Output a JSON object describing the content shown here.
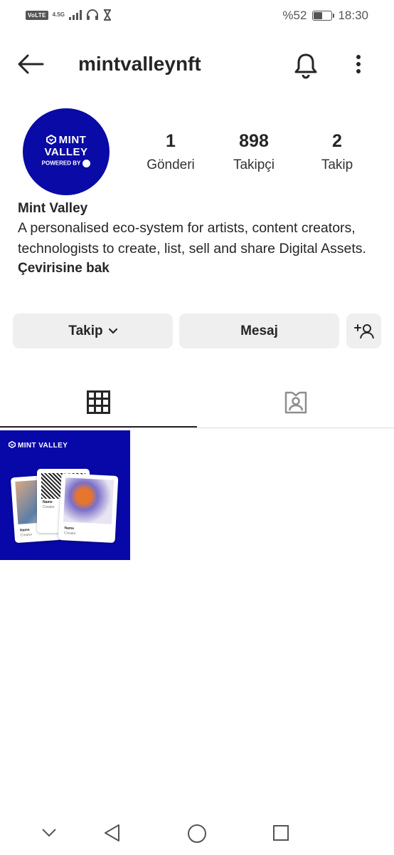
{
  "status_bar": {
    "volte": "VoLTE",
    "network": "4.5G",
    "battery_text": "%52",
    "battery_level": 0.52,
    "time": "18:30"
  },
  "header": {
    "username": "mintvalleynft",
    "back_icon": "arrow-left-icon",
    "bell_icon": "bell-icon",
    "more_icon": "more-vertical-icon"
  },
  "avatar": {
    "brand_text": "MINT VALLEY",
    "powered_text": "POWERED BY",
    "background": "#0a0aa6"
  },
  "stats": [
    {
      "number": "1",
      "label": "Gönderi"
    },
    {
      "number": "898",
      "label": "Takipçi"
    },
    {
      "number": "2",
      "label": "Takip"
    }
  ],
  "bio": {
    "name": "Mint Valley",
    "text": "A personalised eco-system for artists, content creators, technologists to create, list, sell and share Digital Assets.",
    "translate": "Çevirisine bak"
  },
  "actions": {
    "follow_label": "Takip",
    "message_label": "Mesaj",
    "add_user_icon": "add-user-icon"
  },
  "tabs": {
    "grid_icon": "grid-icon",
    "tagged_icon": "tagged-person-icon"
  },
  "post": {
    "brand_text": "MINT VALLEY",
    "card_name": "Name",
    "card_sub": "Creator",
    "background": "#0808a8"
  },
  "colors": {
    "text": "#262626",
    "button_bg": "#efefef",
    "divider": "#dbdbdb"
  }
}
